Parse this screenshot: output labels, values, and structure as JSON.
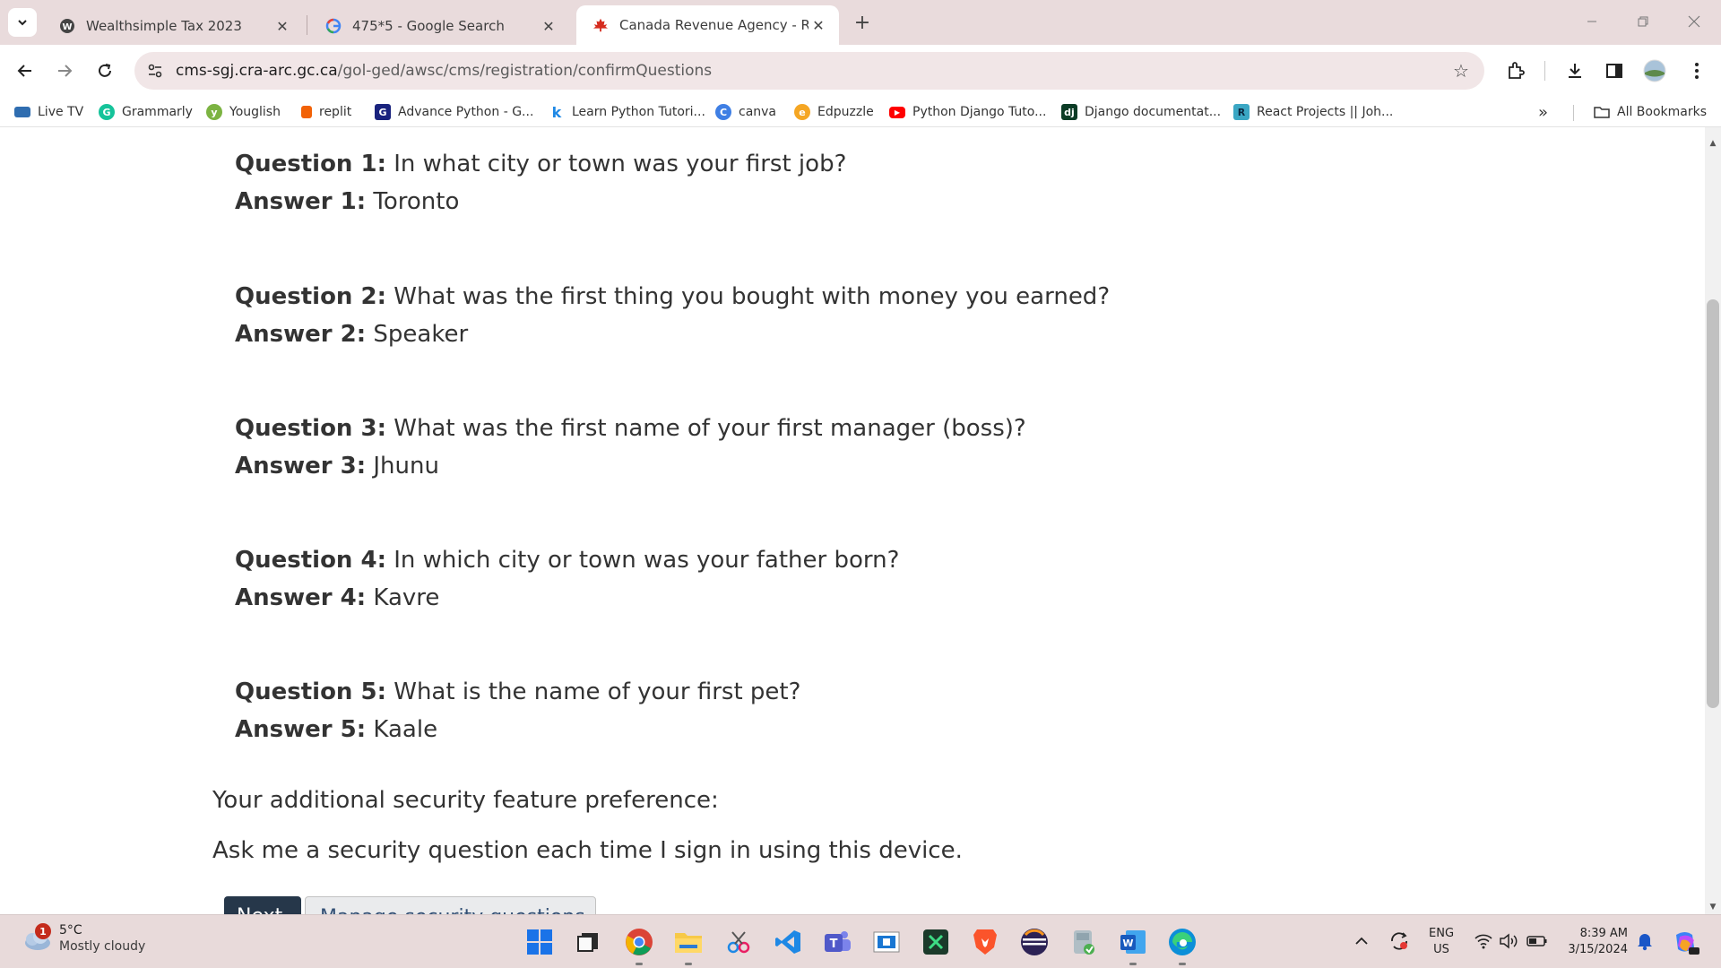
{
  "browser": {
    "tabs": [
      {
        "title": "Wealthsimple Tax 2023",
        "icon": "wealthsimple-icon",
        "active": false
      },
      {
        "title": "475*5 - Google Search",
        "icon": "google-icon",
        "active": false
      },
      {
        "title": "Canada Revenue Agency - Revie",
        "icon": "canada-flag-icon",
        "active": true
      }
    ],
    "url_host": "cms-sgj.cra-arc.gc.ca",
    "url_path": "/gol-ged/awsc/cms/registration/confirmQuestions",
    "bookmarks": [
      {
        "label": "Live TV",
        "icon": "live-tv-icon"
      },
      {
        "label": "Grammarly",
        "icon": "grammarly-icon"
      },
      {
        "label": "Youglish",
        "icon": "youglish-icon"
      },
      {
        "label": "replit",
        "icon": "replit-icon"
      },
      {
        "label": "Advance Python - G...",
        "icon": "g-icon"
      },
      {
        "label": "Learn Python Tutori...",
        "icon": "k-icon"
      },
      {
        "label": "canva",
        "icon": "canva-icon"
      },
      {
        "label": "Edpuzzle",
        "icon": "edpuzzle-icon"
      },
      {
        "label": "Python Django Tuto...",
        "icon": "youtube-icon"
      },
      {
        "label": "Django documentat...",
        "icon": "django-icon"
      },
      {
        "label": "React Projects || Joh...",
        "icon": "react-icon"
      }
    ],
    "all_bookmarks": "All Bookmarks"
  },
  "page": {
    "qa": [
      {
        "q_label": "Question 1:",
        "q_text": " In what city or town was your first job?",
        "a_label": "Answer 1:",
        "a_text": " Toronto"
      },
      {
        "q_label": "Question 2:",
        "q_text": " What was the first thing you bought with money you earned?",
        "a_label": "Answer 2:",
        "a_text": " Speaker"
      },
      {
        "q_label": "Question 3:",
        "q_text": " What was the first name of your first manager (boss)?",
        "a_label": "Answer 3:",
        "a_text": " Jhunu"
      },
      {
        "q_label": "Question 4:",
        "q_text": " In which city or town was your father born?",
        "a_label": "Answer 4:",
        "a_text": " Kavre"
      },
      {
        "q_label": "Question 5:",
        "q_text": " What is the name of your first pet?",
        "a_label": "Answer 5:",
        "a_text": " Kaale"
      }
    ],
    "pref_heading": "Your additional security feature preference:",
    "pref_value": "Ask me a security question each time I sign in using this device.",
    "next_button": "Next",
    "manage_button": "Manage security questions"
  },
  "taskbar": {
    "weather_temp": "5°C",
    "weather_cond": "Mostly cloudy",
    "weather_badge": "1",
    "lang_line1": "ENG",
    "lang_line2": "US",
    "time": "8:39 AM",
    "date": "3/15/2024"
  },
  "colors": {
    "tabstrip_bg": "#e9dbdc",
    "omnibox_bg": "#f1e6e7",
    "next_button_bg": "#26374a",
    "taskbar_bg": "#e8dada"
  }
}
